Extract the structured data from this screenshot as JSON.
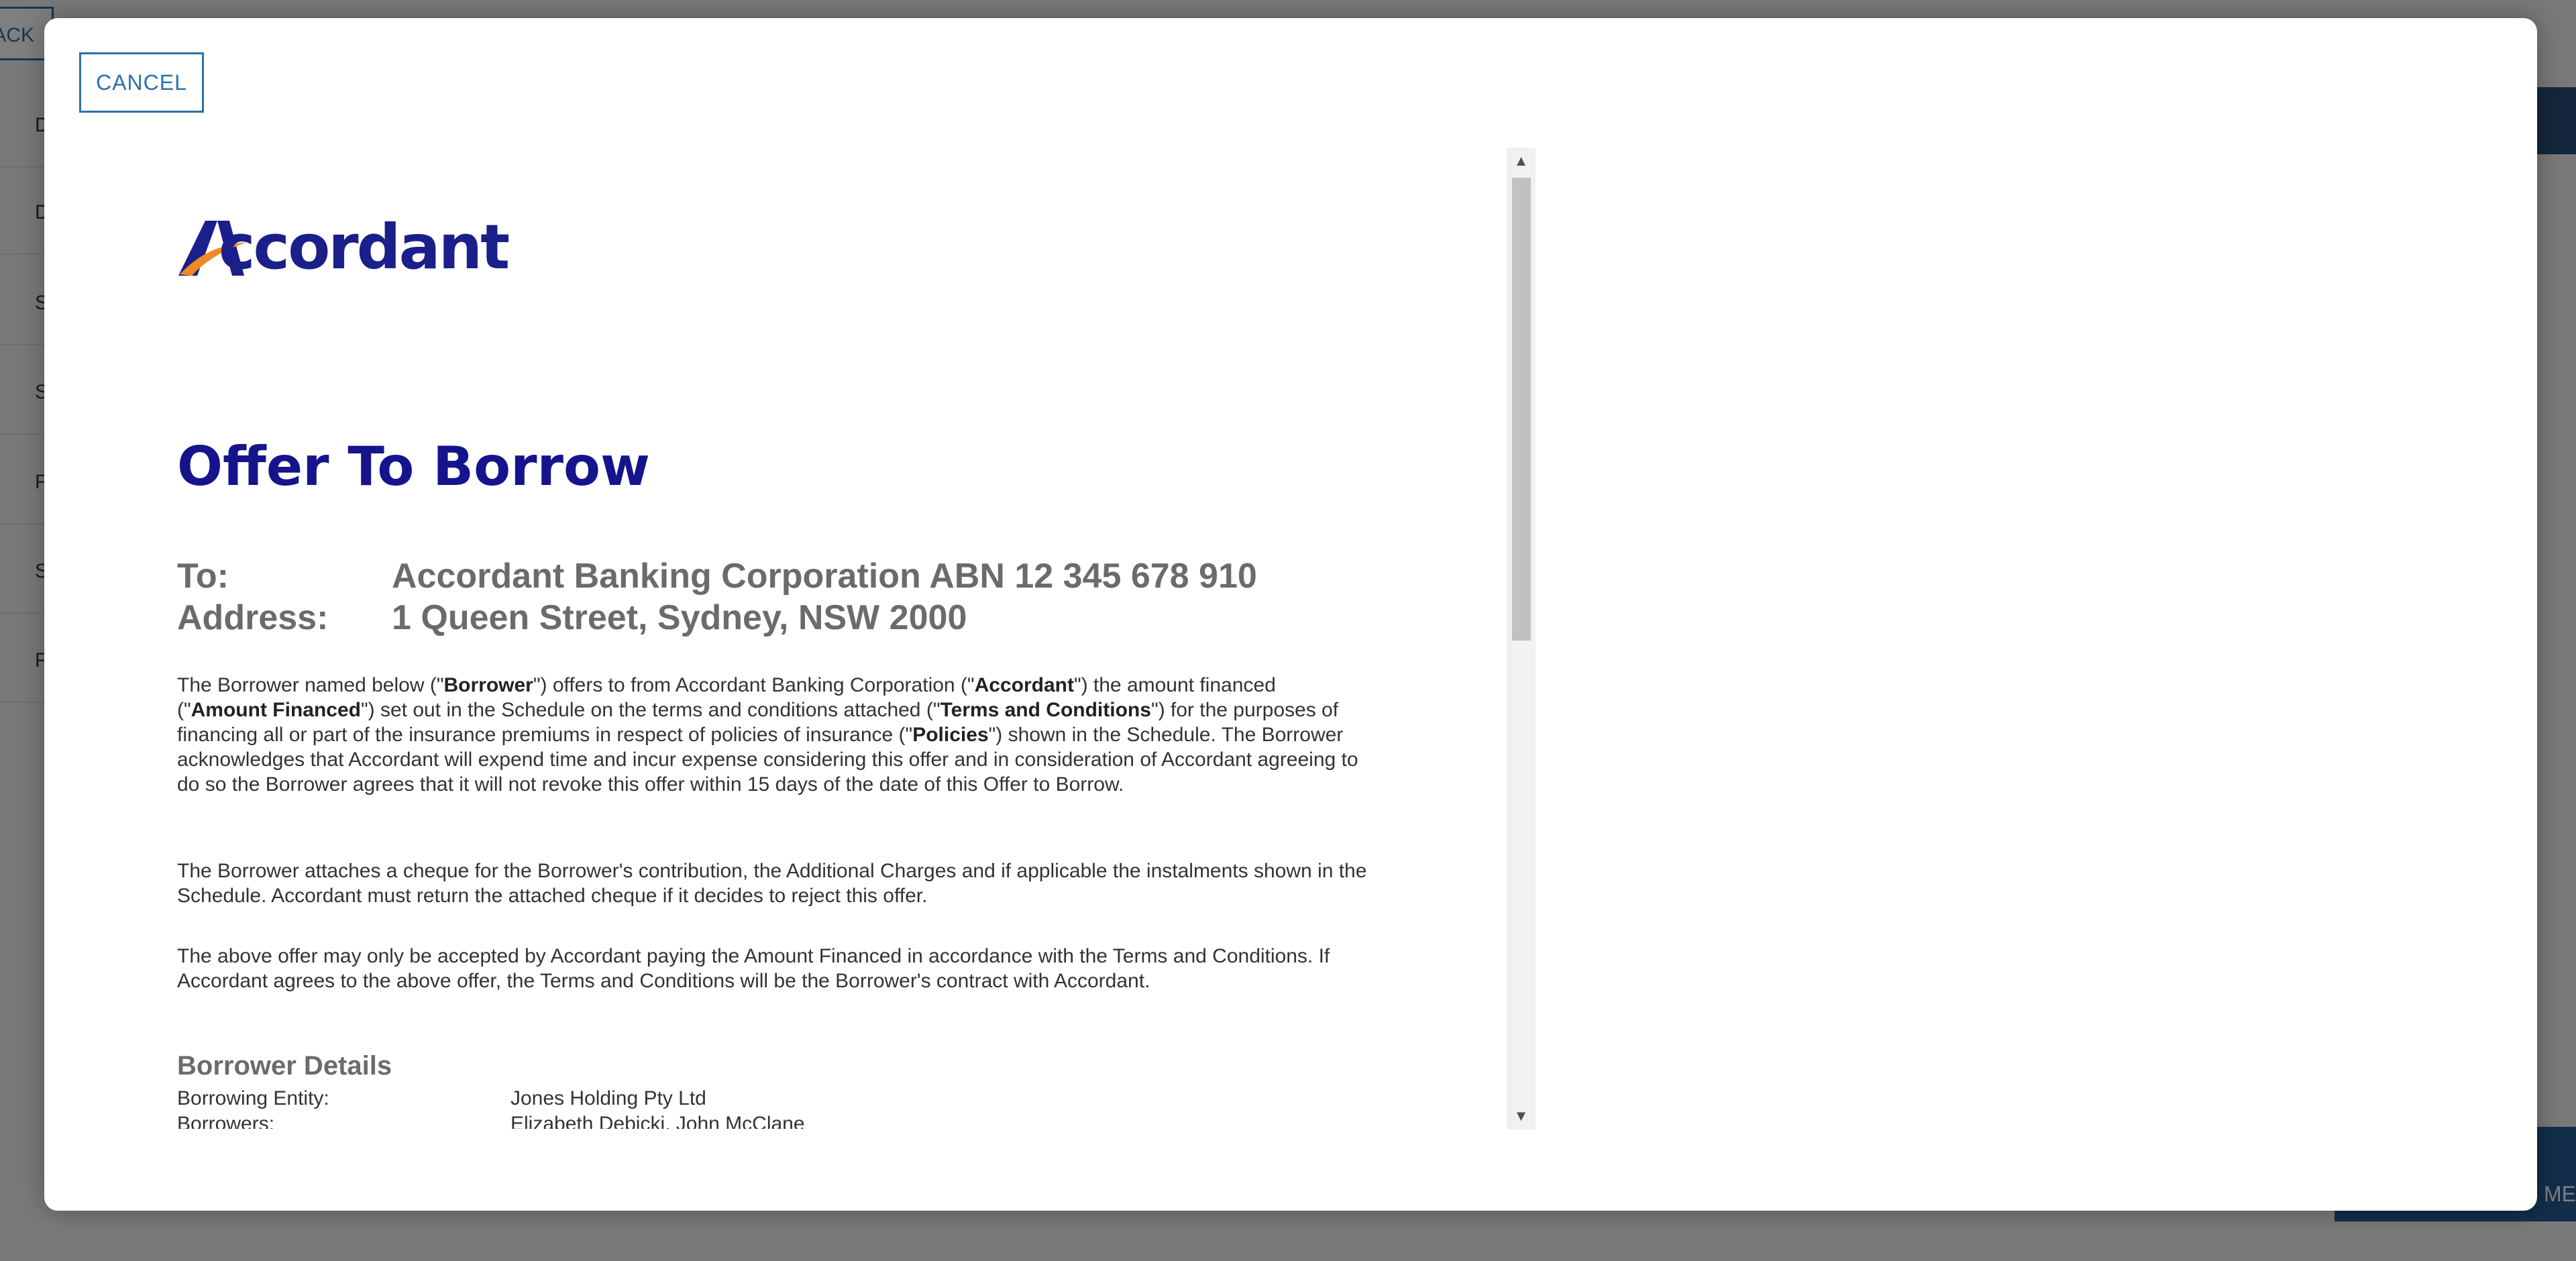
{
  "background": {
    "back_label": "ACK",
    "sidebar_letters": [
      "D",
      "D",
      "S",
      "S",
      "F",
      "S",
      "F"
    ],
    "bottom_right_label": "ME"
  },
  "modal": {
    "cancel_label": "CANCEL"
  },
  "document": {
    "logo_text": "ccordant",
    "logo_letter": "A",
    "title": "Offer To Borrow",
    "to_label": "To:",
    "to_value": "Accordant Banking Corporation ABN 12 345 678 910",
    "address_label": "Address:",
    "address_value": "1 Queen Street, Sydney, NSW 2000",
    "para1": {
      "t1": "The Borrower named below (\"",
      "b1": "Borrower",
      "t2": "\") offers to from Accordant Banking Corporation (\"",
      "b2": "Accordant",
      "t3": "\") the amount financed (\"",
      "b3": "Amount Financed",
      "t4": "\") set out in the Schedule on the terms and conditions attached (\"",
      "b4": "Terms and Conditions",
      "t5": "\") for the purposes of financing all or part of the insurance premiums in respect of policies of insurance (\"",
      "b5": "Policies",
      "t6": "\") shown in the Schedule. The Borrower acknowledges that Accordant will expend time and incur expense considering this offer and in consideration of Accordant agreeing to do so the Borrower agrees that it will not revoke this offer within 15 days of the date of this Offer to Borrow."
    },
    "para2": "The Borrower attaches a cheque for the Borrower's contribution, the Additional Charges and if applicable the instalments shown in the Schedule. Accordant must return the attached cheque if it decides to reject this offer.",
    "para3": "The above offer may only be accepted by Accordant paying the Amount Financed in accordance with the Terms and Conditions. If Accordant agrees to the above offer, the Terms and Conditions will be the Borrower's contract with Accordant.",
    "borrower_heading": "Borrower Details",
    "borrowing_entity_label": "Borrowing Entity:",
    "borrowing_entity_value": "Jones Holding Pty Ltd",
    "borrowers_label": "Borrowers:",
    "borrowers_value": "Elizabeth Debicki, John McClane"
  },
  "colors": {
    "brand_navy": "#15148c",
    "accent_orange": "#f08a24",
    "link_blue": "#2f6fa6"
  }
}
